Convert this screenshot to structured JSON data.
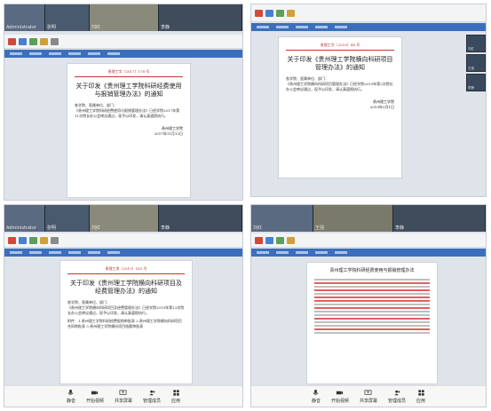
{
  "panels": [
    {
      "cams": [
        {
          "name": "Administrator"
        },
        {
          "name": "张明"
        },
        {
          "name": "刘红"
        },
        {
          "name": "李静"
        }
      ],
      "doc": {
        "doc_no": "贵理工字〔2017〕178 号",
        "title": "关于印发《贵州理工学院科研经费使用与报销管理办法》的通知",
        "salutation": "各学院、直属单位、部门：",
        "body": "《贵州理工学院科研经费使用与报销管理办法》已经学院2017年第11次院长办公会审议通过，现予以印发，请认真遵照执行。",
        "sign": "贵州理工学院",
        "date": "2017年11月12日"
      }
    },
    {
      "cams": [
        {
          "name": "刘红"
        },
        {
          "name": "王强"
        },
        {
          "name": "李静"
        }
      ],
      "doc": {
        "doc_no": "贵理工字〔2019〕48 号",
        "title": "关于印发《贵州理工学院横向科研项目管理办法》的通知",
        "salutation": "各学院、直属单位、部门：",
        "body": "《贵州理工学院横向科研项目管理办法》已经学院2019年第3次院长办公会审议通过，现予以印发，请认真遵照执行。",
        "sign": "贵州理工学院",
        "date": "2019年3月1日"
      }
    },
    {
      "cams": [
        {
          "name": "Administrator"
        },
        {
          "name": "张明"
        },
        {
          "name": "刘红"
        },
        {
          "name": "李静"
        }
      ],
      "doc": {
        "doc_no": "贵理工发〔2019〕163 号",
        "title": "关于印发《贵州理工学院横向科研项目及经费管理办法》的通知",
        "salutation": "各学院、直属单位、部门：",
        "body": "《贵州理工学院横向科研项目及经费管理办法》已经学院2019年第13次院长办公会审议通过，现予以印发，请认真遵照执行。",
        "attach": "附件：1.贵州理工学院科研经费报销审批表  2.贵州理工学院横向科研项目合同审批表  3.贵州理工学院横向项目结题审批表"
      },
      "bottom_bar": [
        "静音",
        "开始视频",
        "共享屏幕",
        "管理成员",
        "应用"
      ]
    },
    {
      "cams": [
        {
          "name": "刘红"
        },
        {
          "name": "王强"
        },
        {
          "name": "李静"
        }
      ],
      "doc": {
        "title": "贵州理工学院科研经费使用与报销管理办法"
      },
      "bottom_bar": [
        "静音",
        "开始视频",
        "共享屏幕",
        "管理成员",
        "应用"
      ]
    }
  ],
  "bottom_bar_labels": [
    "静音",
    "开始视频",
    "共享屏幕",
    "管理成员",
    "应用"
  ]
}
